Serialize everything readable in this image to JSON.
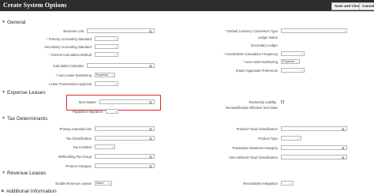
{
  "header": {
    "title": "Create System Options",
    "save_close_label": "Save and Close",
    "cancel_label": "Cancel"
  },
  "sections": {
    "general": "General",
    "expense_leases": "Expense Leases",
    "tax_determinants": "Tax Determinants",
    "revenue_leases": "Revenue Leases",
    "additional_information": "Additional Information"
  },
  "general": {
    "business_unit": "Business Unit",
    "primary_accounting_standard": "Primary Accounting Standard",
    "secondary_accounting_standard": "Secondary Accounting Standard",
    "interest_calculation_method": "Interest Calculation Method",
    "calculation_calendar": "Calculation Calendar",
    "auto_lease_numbering": "Auto Lease Numbering",
    "auto_lease_numbering_value": "Expense",
    "lease_transactions_approval": "Lease Transactions Approval",
    "default_currency_conversion_type": "Default Currency Conversion Type",
    "ledger_name": "Ledger Name",
    "secondary_ledger": "Secondary Ledger",
    "amortization_calculation_frequency": "Amortization Calculation Frequency",
    "auto_asset_numbering": "Auto Asset Numbering",
    "auto_asset_numbering_value": "Expense",
    "import_approvals_preference": "Import Approvals Preference"
  },
  "expense": {
    "item_master": "Item Master",
    "payables_integration": "Payables Integration",
    "reclassify_liability": "Reclassify Liability",
    "reclassification_effective_from_date": "Reclassification Effective from Date"
  },
  "tax": {
    "primary_intended_use": "Primary Intended Use",
    "tax_classification": "Tax Classification",
    "tax_included": "Tax Included",
    "withholding_tax_group": "Withholding Tax Group",
    "product_category": "Product Category",
    "product_fiscal_classification": "Product Fiscal Classification",
    "product_type": "Product Type",
    "transaction_business_category": "Transaction Business Category",
    "user_defined_fiscal_classification": "User-defined Fiscal Classification"
  },
  "revenue": {
    "enable_revenue_leases": "Enable Revenue Leases",
    "enable_revenue_leases_value": "None",
    "receivables_integration": "Receivables Integration"
  },
  "colors": {
    "title_bar": "#2d2d2d",
    "highlight": "#d9262a"
  }
}
